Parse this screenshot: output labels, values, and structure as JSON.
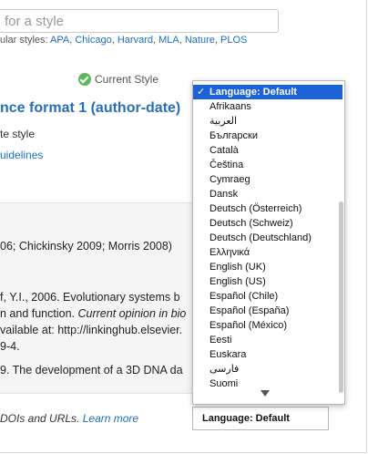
{
  "search": {
    "placeholder": "for a style"
  },
  "popular": {
    "label": "ular styles:",
    "links": [
      "APA",
      "Chicago",
      "Harvard",
      "MLA",
      "Nature",
      "PLOS"
    ]
  },
  "current_style": {
    "label": "Current Style"
  },
  "style": {
    "title": "nce format 1 (author-date)",
    "subtitle": "te style",
    "guidelines_link": "uidelines"
  },
  "preview": {
    "lines": [
      "06; Chickinsky 2009; Morris 2008)",
      "f, Y.I., 2006. Evolutionary systems b",
      "n and function. ",
      "vailable at: http://linkinghub.elsevier.",
      "9-4.",
      "9. The development of a 3D DNA da"
    ],
    "italic_fragment": "Current opinion in bio"
  },
  "footer": {
    "text": "DOIs and URLs.",
    "link": "Learn more"
  },
  "language_select": {
    "value": "Language: Default"
  },
  "language_dropdown": {
    "options": [
      "Language: Default",
      "Afrikaans",
      "العربية",
      "Български",
      "Català",
      "Čeština",
      "Cymraeg",
      "Dansk",
      "Deutsch (Österreich)",
      "Deutsch (Schweiz)",
      "Deutsch (Deutschland)",
      "Ελληνικά",
      "English (UK)",
      "English (US)",
      "Español (Chile)",
      "Español (España)",
      "Español (México)",
      "Eesti",
      "Euskara",
      "فارسی",
      "Suomi"
    ],
    "selected_index": 0
  }
}
